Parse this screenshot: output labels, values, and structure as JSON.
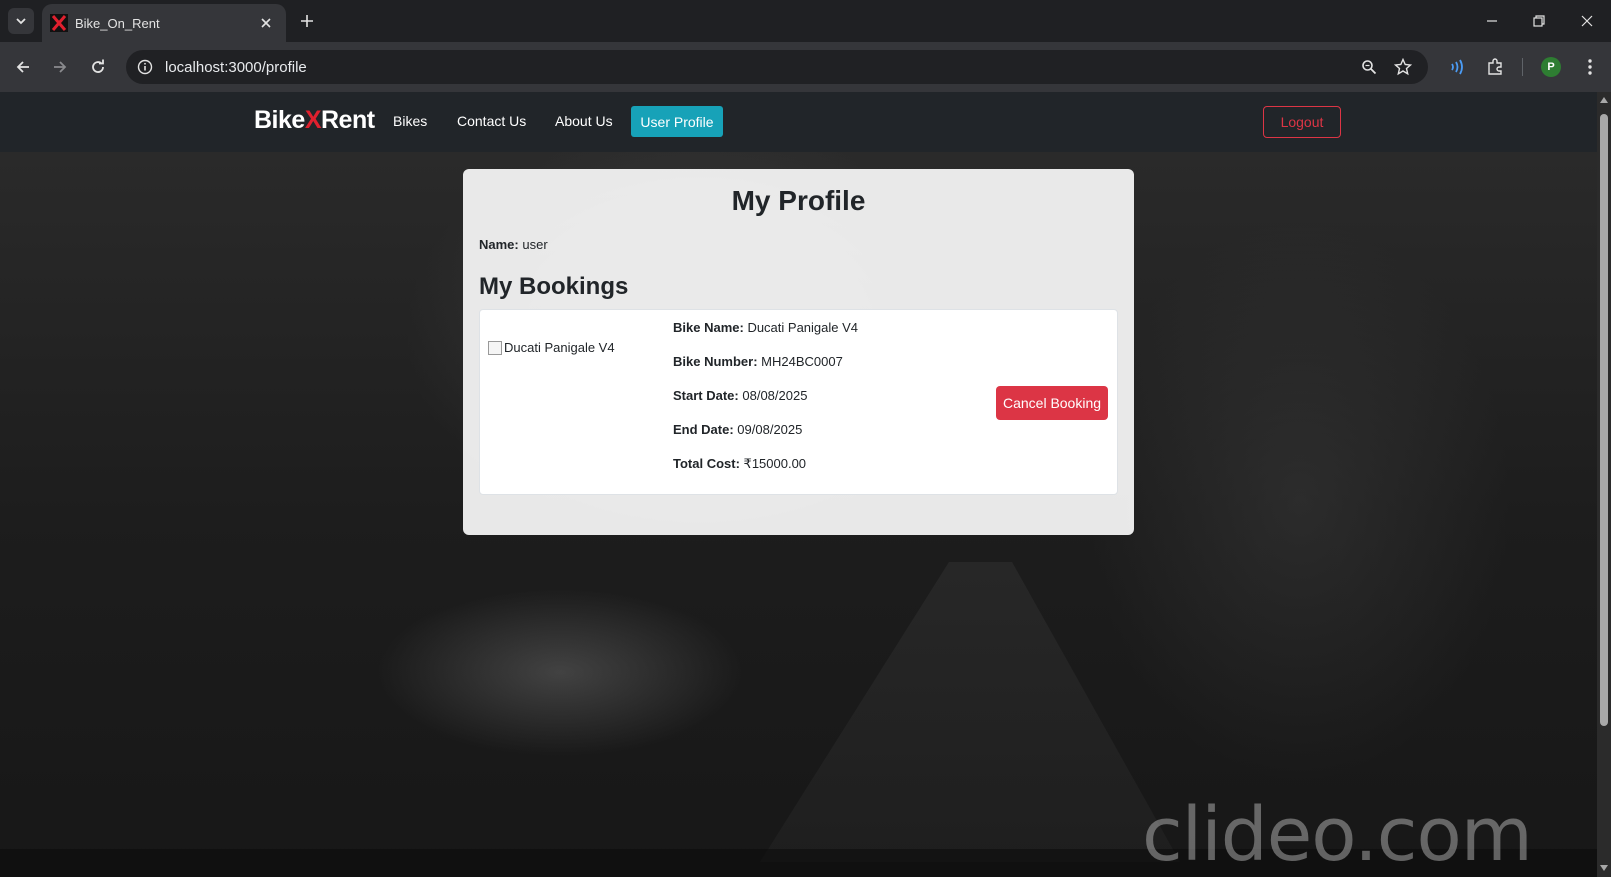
{
  "browser": {
    "tab_title": "Bike_On_Rent",
    "url": "localhost:3000/profile",
    "profile_initial": "P",
    "icons": [
      "tab-list-icon",
      "close-icon",
      "plus-icon",
      "minimize-icon",
      "restore-icon",
      "back-icon",
      "forward-icon",
      "reload-icon",
      "info-icon",
      "zoom-icon",
      "star-icon",
      "cast-icon",
      "extensions-icon",
      "menu-icon"
    ]
  },
  "navbar": {
    "brand_prefix": "Bike",
    "brand_x": "X",
    "brand_suffix": "Rent",
    "links": [
      "Bikes",
      "Contact Us",
      "About Us"
    ],
    "active_link": "User Profile",
    "logout": "Logout"
  },
  "profile": {
    "title": "My Profile",
    "name_label": "Name:",
    "name_value": "user",
    "bookings_title": "My Bookings"
  },
  "booking": {
    "image_alt": "Ducati Panigale V4",
    "fields": [
      {
        "label": "Bike Name:",
        "value": "Ducati Panigale V4"
      },
      {
        "label": "Bike Number:",
        "value": "MH24BC0007"
      },
      {
        "label": "Start Date:",
        "value": "08/08/2025"
      },
      {
        "label": "End Date:",
        "value": "09/08/2025"
      },
      {
        "label": "Total Cost:",
        "value": "₹15000.00"
      }
    ],
    "cancel_label": "Cancel Booking"
  },
  "watermark": "clideo.com",
  "colors": {
    "brand_accent": "#e0202e",
    "active_nav": "#17a2b8",
    "danger": "#dc3545",
    "navbar_bg": "#212529"
  }
}
